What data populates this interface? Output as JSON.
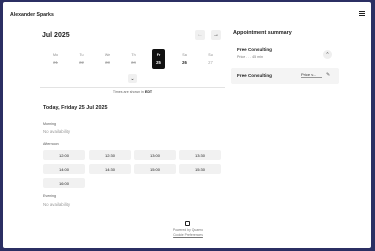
{
  "header": {
    "title": "Alexander Sparks",
    "menu_icon": "hamburger-menu-icon"
  },
  "calendar": {
    "month_label": "Jul 2025",
    "prev_icon": "arrow-left-icon",
    "next_icon": "arrow-right-icon",
    "prev_glyph": "←",
    "next_glyph": "→",
    "days": [
      {
        "name": "Mo",
        "date": "21",
        "state": "unavailable"
      },
      {
        "name": "Tu",
        "date": "22",
        "state": "unavailable"
      },
      {
        "name": "We",
        "date": "23",
        "state": "unavailable"
      },
      {
        "name": "Th",
        "date": "24",
        "state": "unavailable"
      },
      {
        "name": "Fr",
        "date": "25",
        "state": "selected"
      },
      {
        "name": "Sa",
        "date": "26",
        "state": "available"
      },
      {
        "name": "Su",
        "date": "27",
        "state": "faded"
      }
    ],
    "expand_glyph": "⌄",
    "timezone_prefix": "Times are shown in",
    "timezone": "EDT"
  },
  "schedule": {
    "date_heading": "Today, Friday 25 Jul 2025",
    "morning_label": "Morning",
    "morning_status": "No availability",
    "afternoon_label": "Afternoon",
    "afternoon_slots": [
      "12:00",
      "12:30",
      "13:00",
      "13:30",
      "14:00",
      "14:30",
      "15:00",
      "15:30",
      "16:00"
    ],
    "evening_label": "Evening",
    "evening_status": "No availability"
  },
  "summary": {
    "title": "Appointment summary",
    "item1": {
      "name": "Free Consulting",
      "sub": "Price . . . 45 min",
      "collapse_glyph": "⌃"
    },
    "item2": {
      "name": "Free Consulting",
      "price_select": "Price v...",
      "edit_icon": "pencil-icon",
      "edit_glyph": "✎"
    }
  },
  "footer": {
    "powered": "Powered by Quaero",
    "link": "Cookie Preferences"
  }
}
